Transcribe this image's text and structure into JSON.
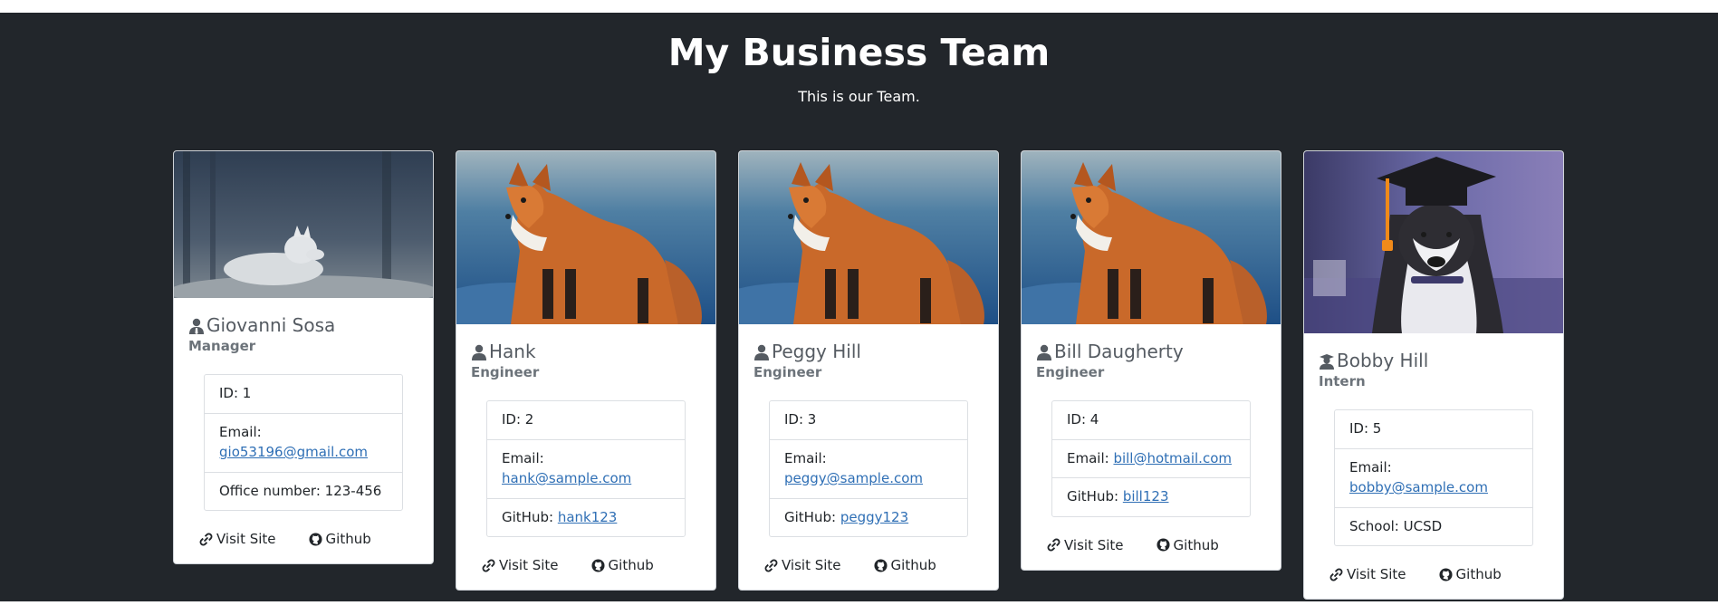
{
  "header": {
    "title": "My Business Team",
    "subtitle": "This is our Team."
  },
  "members": [
    {
      "name": "Giovanni Sosa",
      "role": "Manager",
      "role_icon": "manager-icon",
      "photo": "white-wolf-photo",
      "id_text": "ID: 1",
      "email_label": "Email:",
      "email": "gio53196@gmail.com",
      "extra_text": "Office number: 123-456",
      "visit_label": "Visit Site",
      "github_label": "Github"
    },
    {
      "name": "Hank",
      "role": "Engineer",
      "role_icon": "engineer-icon",
      "photo": "red-fox-photo",
      "id_text": "ID: 2",
      "email_label": "Email:",
      "email": "hank@sample.com",
      "github_prefix": "GitHub:",
      "github_user": "hank123",
      "visit_label": "Visit Site",
      "github_label": "Github"
    },
    {
      "name": "Peggy Hill",
      "role": "Engineer",
      "role_icon": "engineer-icon",
      "photo": "red-fox-photo",
      "id_text": "ID: 3",
      "email_label": "Email:",
      "email": "peggy@sample.com",
      "github_prefix": "GitHub:",
      "github_user": "peggy123",
      "visit_label": "Visit Site",
      "github_label": "Github"
    },
    {
      "name": "Bill Daugherty",
      "role": "Engineer",
      "role_icon": "engineer-icon",
      "photo": "red-fox-photo",
      "id_text": "ID: 4",
      "email_label": "Email:",
      "email": "bill@hotmail.com",
      "github_prefix": "GitHub:",
      "github_user": "bill123",
      "visit_label": "Visit Site",
      "github_label": "Github"
    },
    {
      "name": "Bobby Hill",
      "role": "Intern",
      "role_icon": "graduate-icon",
      "photo": "husky-graduate-photo",
      "id_text": "ID: 5",
      "email_label": "Email:",
      "email": "bobby@sample.com",
      "extra_text": "School: UCSD",
      "visit_label": "Visit Site",
      "github_label": "Github"
    }
  ],
  "colors": {
    "background": "#22262b",
    "link": "#2f6fb5"
  }
}
